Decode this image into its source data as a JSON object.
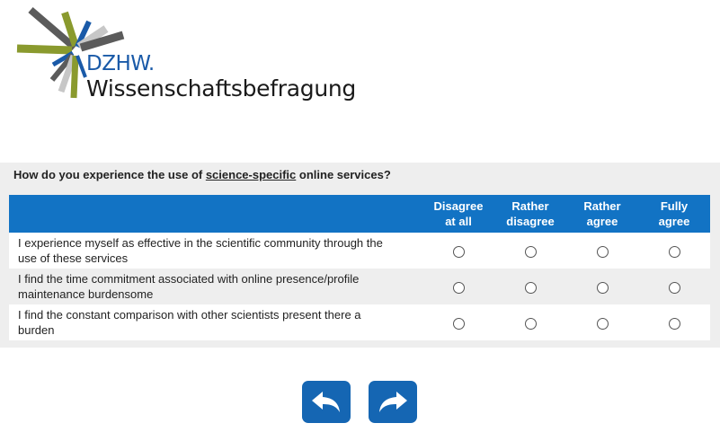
{
  "brand": {
    "abbr": "DZHW.",
    "name": "Wissenschaftsbefragung"
  },
  "question": {
    "prefix": "How do you experience the use of ",
    "emphasis": "science-specific",
    "suffix": " online services?"
  },
  "scale": {
    "col1_line1": "Disagree",
    "col1_line2": "at all",
    "col2_line1": "Rather",
    "col2_line2": "disagree",
    "col3_line1": "Rather",
    "col3_line2": "agree",
    "col4_line1": "Fully",
    "col4_line2": "agree"
  },
  "items": [
    {
      "line1": "I experience myself as effective in the scientific community through the",
      "line2": "use of these services"
    },
    {
      "line1": "I find the time commitment associated with online presence/profile",
      "line2": "maintenance burdensome"
    },
    {
      "line1": "I find the constant comparison with other scientists present there a",
      "line2": "burden"
    }
  ],
  "nav": {
    "back_icon": "arrow-back-icon",
    "next_icon": "arrow-forward-icon"
  },
  "colors": {
    "header_blue": "#1273c4",
    "button_blue": "#1566b3",
    "panel_gray": "#eeeeee"
  }
}
